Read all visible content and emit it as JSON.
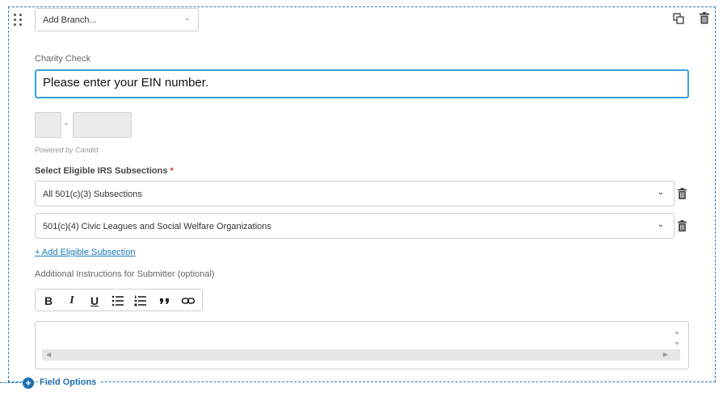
{
  "branch": {
    "placeholder": "Add Branch...",
    "chevron": "chevron-down-icon"
  },
  "field": {
    "title": "Charity Check",
    "input_value": "Please enter your EIN number.",
    "ein_separator": "-",
    "powered_by": "Powered by Candid"
  },
  "irs": {
    "label": "Select Eligible IRS Subsections",
    "required_marker": "*",
    "selections": [
      "All 501(c)(3) Subsections",
      "501(c)(4) Civic Leagues and Social Welfare Organizations"
    ],
    "add_link": "+ Add Eligible Subsection"
  },
  "instructions": {
    "label": "Additional Instructions for Submitter (optional)",
    "toolbar": [
      "B",
      "I",
      "U",
      "bullet-list-icon",
      "numbered-list-icon",
      "quote-icon",
      "link-icon"
    ]
  },
  "footer": {
    "field_options": "Field Options"
  },
  "colors": {
    "accent": "#1e6fb0",
    "focus_border": "#3aa0d8",
    "required": "#dd3333"
  }
}
